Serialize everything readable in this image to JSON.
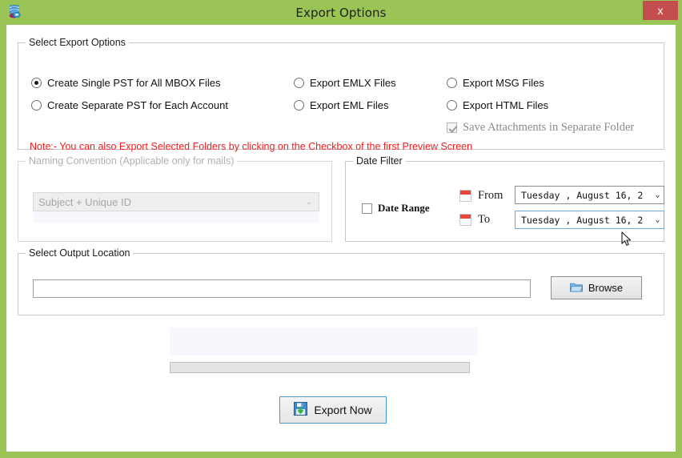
{
  "window": {
    "title": "Export Options",
    "icon": "app-database-icon",
    "close_label": "x",
    "titlebar_color": "#9ac556",
    "close_color": "#c44d4d"
  },
  "export_options": {
    "group_title": "Select Export Options",
    "radios": [
      {
        "id": "single",
        "label": "Create Single PST for All MBOX Files",
        "checked": true
      },
      {
        "id": "separate",
        "label": "Create Separate PST for Each Account",
        "checked": false
      },
      {
        "id": "emlx",
        "label": "Export EMLX Files",
        "checked": false
      },
      {
        "id": "eml",
        "label": "Export EML Files",
        "checked": false
      },
      {
        "id": "msg",
        "label": "Export MSG Files",
        "checked": false
      },
      {
        "id": "html",
        "label": "Export HTML Files",
        "checked": false
      }
    ],
    "attachments_checkbox": {
      "label": "Save Attachments in Separate Folder",
      "checked": true,
      "disabled": true
    },
    "note": "Note:- You can also Export Selected Folders by clicking on the Checkbox of the first Preview Screen",
    "note_color": "#f31d1d"
  },
  "naming_convention": {
    "group_title": "Naming Convention (Applicable only for mails)",
    "disabled": true,
    "selected_value": "Subject + Unique ID",
    "chevron": "⌄"
  },
  "date_filter": {
    "group_title": "Date Filter",
    "range_checkbox": {
      "label": "Date Range",
      "checked": false
    },
    "from_label": "From",
    "to_label": "To",
    "from_value": "Tuesday  ,   August   16, 2",
    "to_value": "Tuesday  ,   August   16, 2",
    "arrow": "⌄",
    "to_focused": true
  },
  "output_location": {
    "group_title": "Select Output Location",
    "path_value": "",
    "path_placeholder": "",
    "browse_label": "Browse"
  },
  "progress": {
    "status_text": "",
    "percent": 0
  },
  "actions": {
    "export_label": "Export Now"
  }
}
